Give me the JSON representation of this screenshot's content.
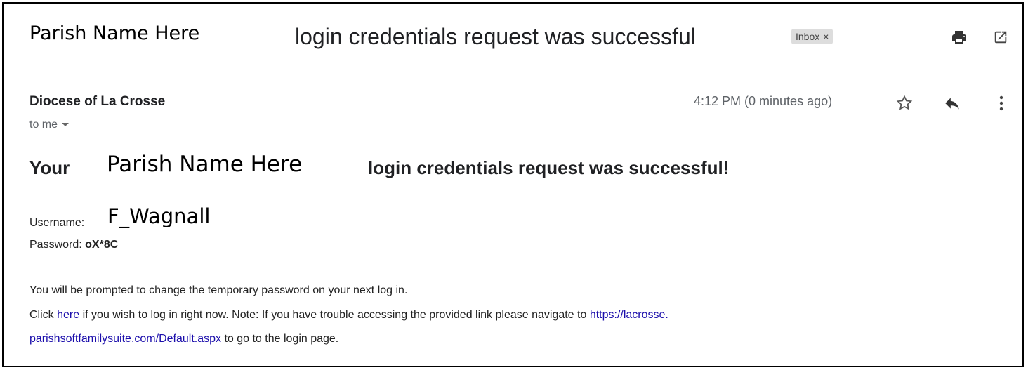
{
  "header": {
    "parish_overlay": "Parish Name Here",
    "subject": "login credentials request was successful",
    "label_chip": "Inbox",
    "label_chip_close": "×"
  },
  "message": {
    "sender": "Diocese of La Crosse",
    "to": "to me",
    "time": "4:12 PM (0 minutes ago)"
  },
  "body": {
    "heading_prefix": "Your",
    "heading_parish": "Parish Name Here",
    "heading_suffix": "login credentials request was successful!",
    "username_label": "Username:",
    "username_value": "F_Wagnall",
    "password_label": "Password:",
    "password_value": "oX*8C",
    "line1": "You will be prompted to change the temporary password on your next log in.",
    "line2_pre": "Click",
    "line2_link": "here",
    "line2_post": "if you wish to log in right now. Note: If you have trouble accessing the provided link please navigate to",
    "url_part1": "https://lacrosse.",
    "url_part2": "parishsoftfamilysuite.com/Default.aspx",
    "line3_post": "to go to the login page."
  },
  "icons": {
    "print": "print-icon",
    "open_new_window": "open-in-new-window-icon",
    "star": "star-icon",
    "reply": "reply-icon",
    "more": "more-vert-icon",
    "dropdown": "dropdown-caret-icon"
  }
}
